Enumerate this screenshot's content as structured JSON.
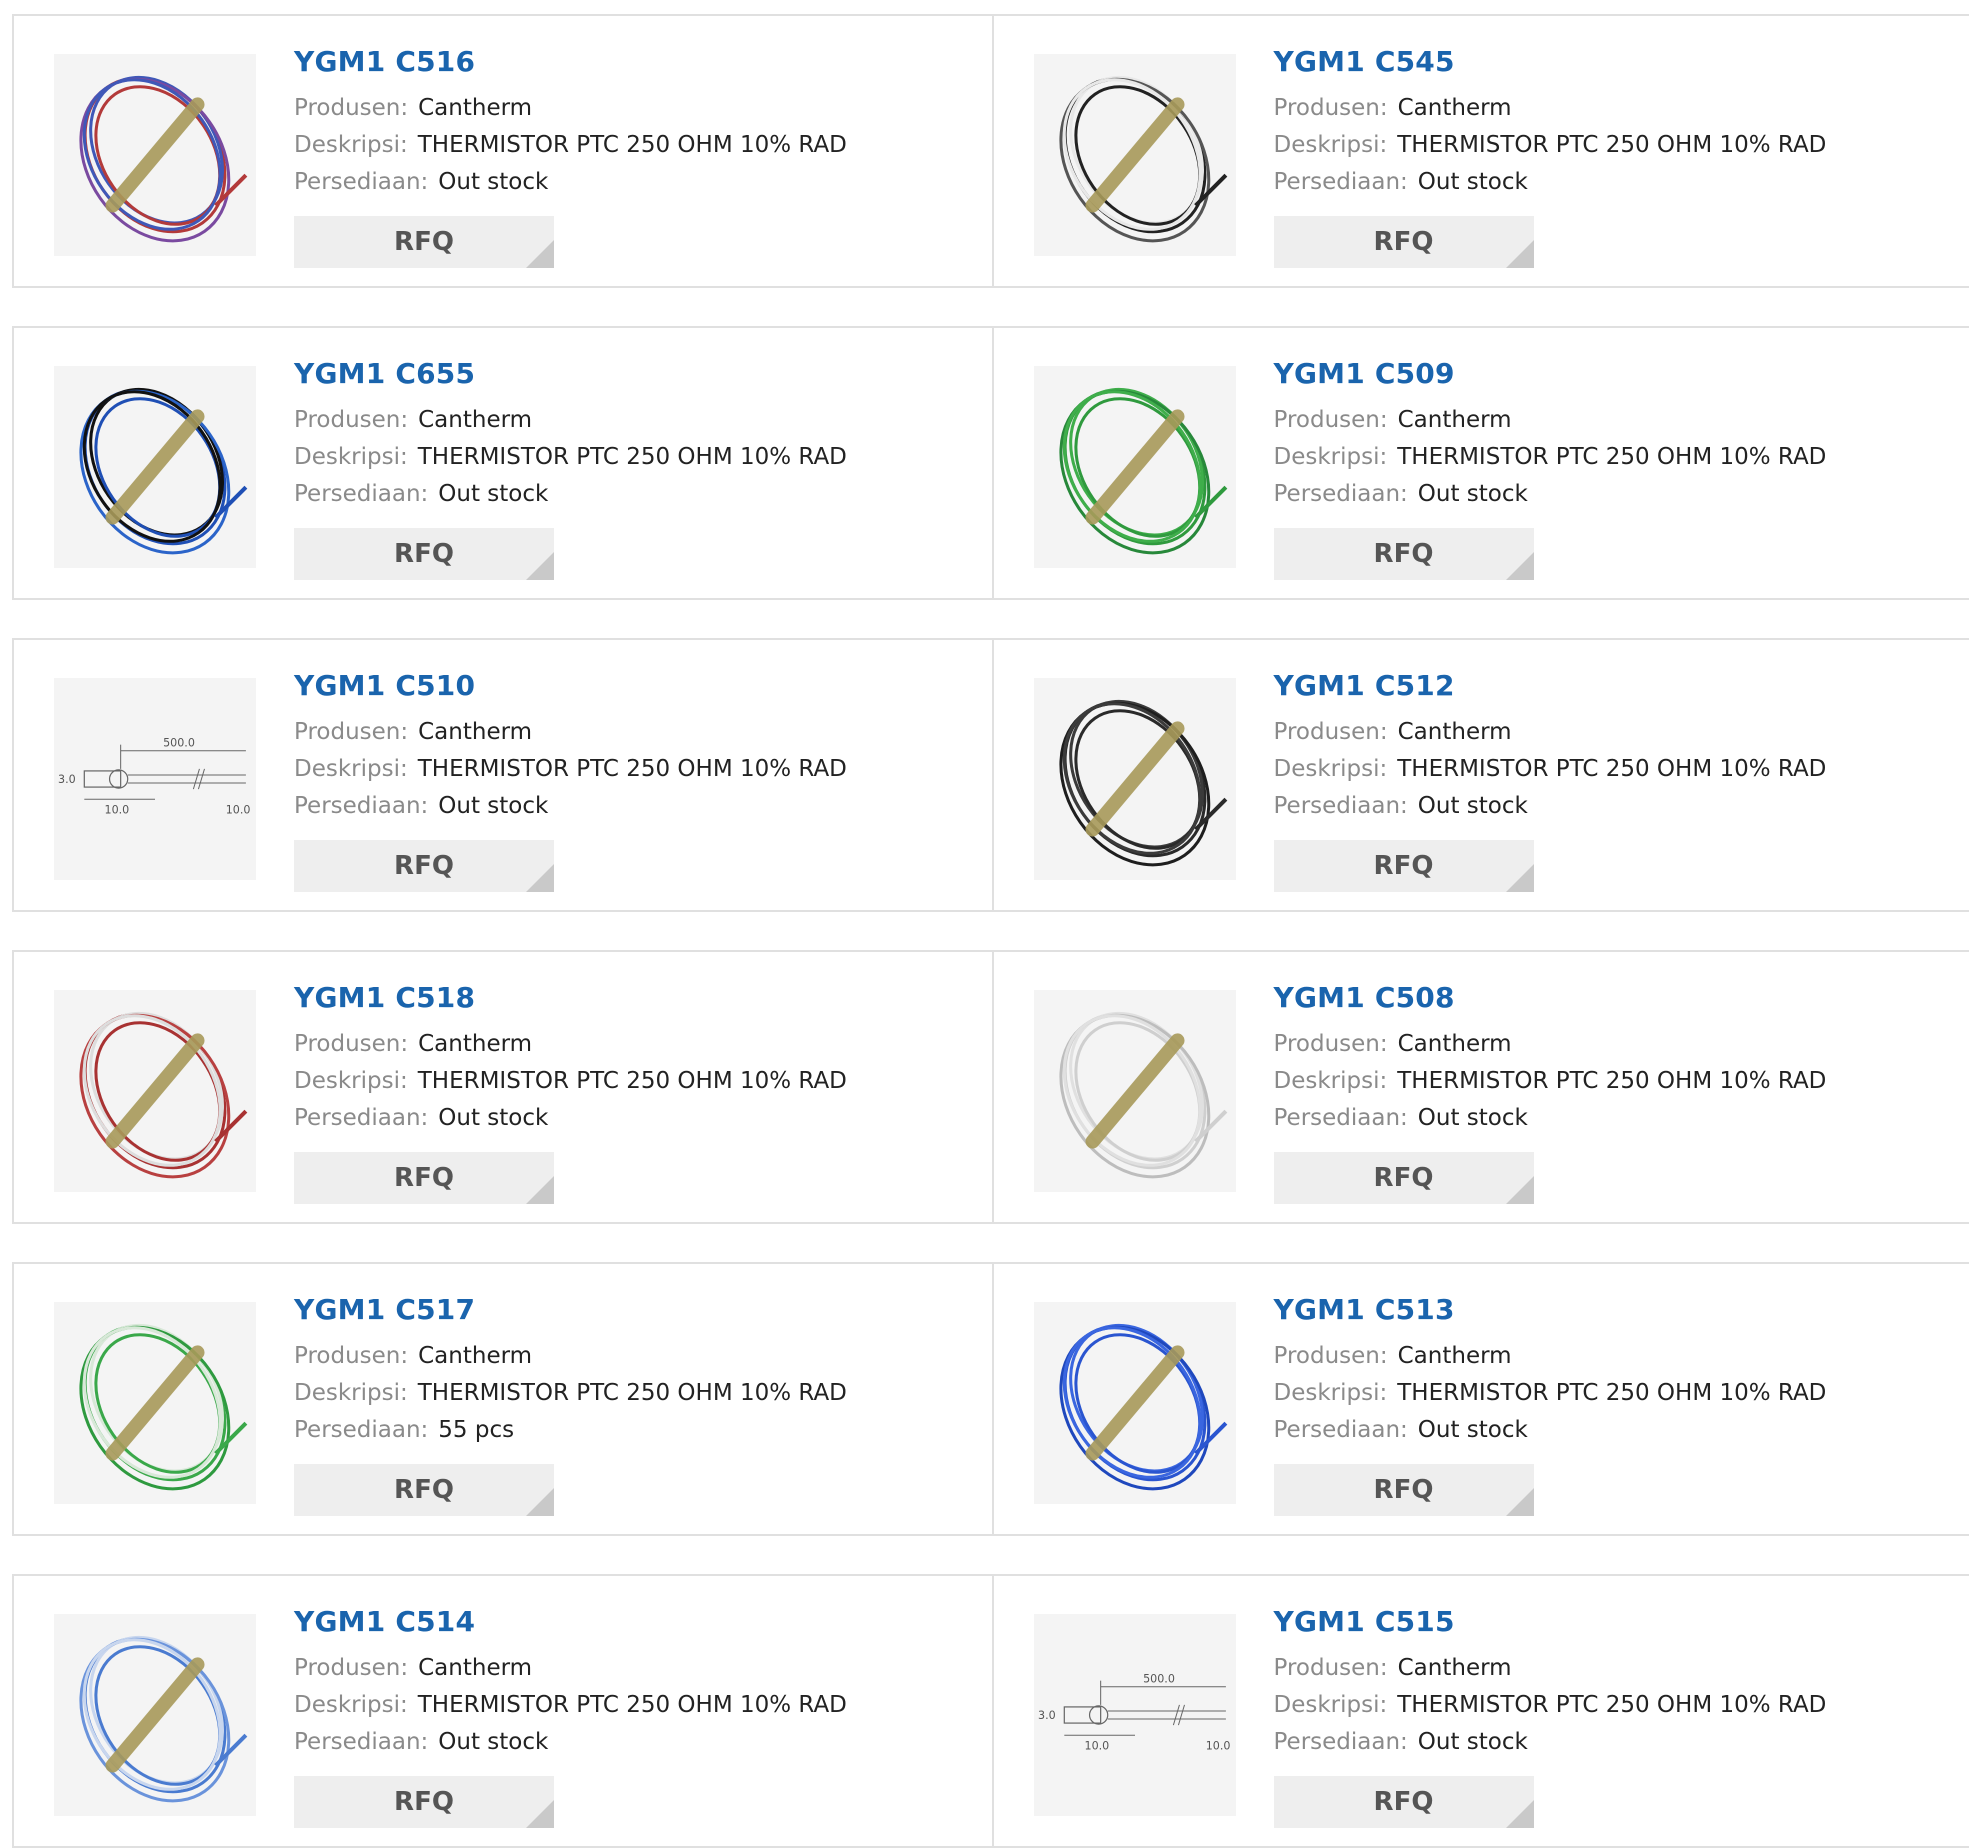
{
  "labels": {
    "manufacturer": "Produsen:",
    "description": "Deskripsi:",
    "stock": "Persediaan:",
    "rfq": "RFQ"
  },
  "products": [
    {
      "part": "YGM1 C516",
      "manufacturer": "Cantherm",
      "description": "THERMISTOR PTC 250 OHM 10% RAD",
      "stock": "Out stock",
      "image": "coil-red-blue"
    },
    {
      "part": "YGM1 C545",
      "manufacturer": "Cantherm",
      "description": "THERMISTOR PTC 250 OHM 10% RAD",
      "stock": "Out stock",
      "image": "coil-black-white"
    },
    {
      "part": "YGM1 C655",
      "manufacturer": "Cantherm",
      "description": "THERMISTOR PTC 250 OHM 10% RAD",
      "stock": "Out stock",
      "image": "coil-blue-black"
    },
    {
      "part": "YGM1 C509",
      "manufacturer": "Cantherm",
      "description": "THERMISTOR PTC 250 OHM 10% RAD",
      "stock": "Out stock",
      "image": "coil-green"
    },
    {
      "part": "YGM1 C510",
      "manufacturer": "Cantherm",
      "description": "THERMISTOR PTC 250 OHM 10% RAD",
      "stock": "Out stock",
      "image": "dimension-drawing"
    },
    {
      "part": "YGM1 C512",
      "manufacturer": "Cantherm",
      "description": "THERMISTOR PTC 250 OHM 10% RAD",
      "stock": "Out stock",
      "image": "coil-black"
    },
    {
      "part": "YGM1 C518",
      "manufacturer": "Cantherm",
      "description": "THERMISTOR PTC 250 OHM 10% RAD",
      "stock": "Out stock",
      "image": "coil-red-white"
    },
    {
      "part": "YGM1 C508",
      "manufacturer": "Cantherm",
      "description": "THERMISTOR PTC 250 OHM 10% RAD",
      "stock": "Out stock",
      "image": "coil-white"
    },
    {
      "part": "YGM1 C517",
      "manufacturer": "Cantherm",
      "description": "THERMISTOR PTC 250 OHM 10% RAD",
      "stock": "55 pcs",
      "image": "coil-green-white"
    },
    {
      "part": "YGM1 C513",
      "manufacturer": "Cantherm",
      "description": "THERMISTOR PTC 250 OHM 10% RAD",
      "stock": "Out stock",
      "image": "coil-blue"
    },
    {
      "part": "YGM1 C514",
      "manufacturer": "Cantherm",
      "description": "THERMISTOR PTC 250 OHM 10% RAD",
      "stock": "Out stock",
      "image": "coil-blue-white"
    },
    {
      "part": "YGM1 C515",
      "manufacturer": "Cantherm",
      "description": "THERMISTOR PTC 250 OHM 10% RAD",
      "stock": "Out stock",
      "image": "dimension-drawing"
    }
  ],
  "drawing": {
    "length": "500.0",
    "dia": "3.0",
    "body": "10.0",
    "lead": "10.0"
  },
  "colors": {
    "title": "#1a64ad",
    "label": "#8a8a8a",
    "border": "#e0e0e0",
    "button_bg": "#eeeeee",
    "button_corner": "#c9c9c9",
    "band": "#a89a5a"
  }
}
